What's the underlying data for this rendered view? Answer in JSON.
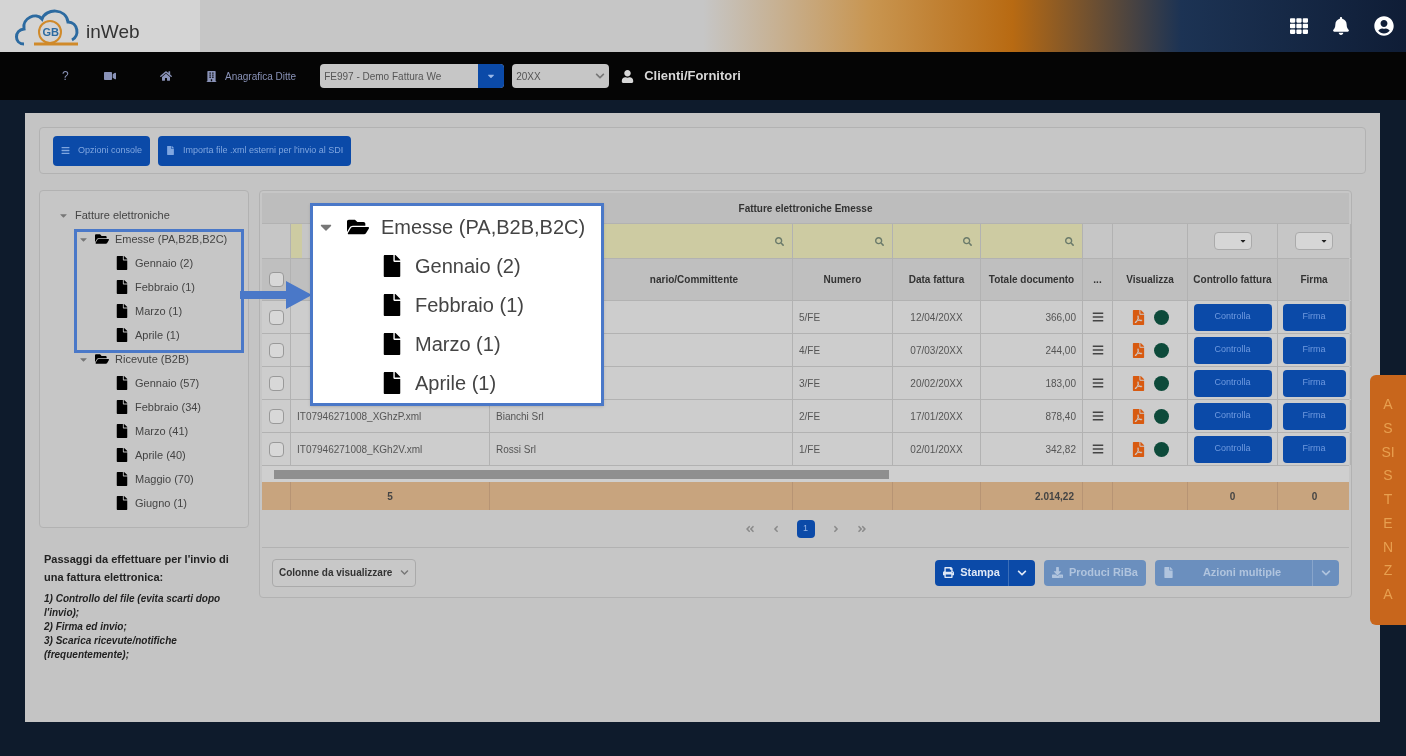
{
  "logo": {
    "mark": "GB",
    "name": "inWeb"
  },
  "nav": {
    "help": "?",
    "company_label": "Anagrafica Ditte",
    "company_select": "FE997 - Demo Fattura We",
    "year_select": "20XX",
    "user": "Clienti/Fornitori"
  },
  "toolbar": {
    "buttons": [
      {
        "kind": "menu",
        "label": "Opzioni console"
      },
      {
        "kind": "file",
        "label": "Importa file .xml esterni per l'invio al SDI"
      }
    ]
  },
  "tree": {
    "label": "Fatture elettroniche",
    "expanded": true,
    "children": [
      {
        "kind": "folder",
        "label": "Emesse (PA,B2B,B2C)",
        "expanded": true,
        "children": [
          {
            "kind": "file",
            "label": "Gennaio (2)"
          },
          {
            "kind": "file",
            "label": "Febbraio (1)"
          },
          {
            "kind": "file",
            "label": "Marzo (1)"
          },
          {
            "kind": "file",
            "label": "Aprile (1)"
          }
        ]
      },
      {
        "kind": "folder",
        "label": "Ricevute (B2B)",
        "expanded": true,
        "children": [
          {
            "kind": "file",
            "label": "Gennaio (57)"
          },
          {
            "kind": "file",
            "label": "Febbraio (34)"
          },
          {
            "kind": "file",
            "label": "Marzo (41)"
          },
          {
            "kind": "file",
            "label": "Aprile (40)"
          },
          {
            "kind": "file",
            "label": "Maggio (70)"
          },
          {
            "kind": "file",
            "label": "Giugno (1)"
          }
        ]
      }
    ]
  },
  "instructions": {
    "title": "Passaggi da effettuare per l'invio di una fattura elettronica:",
    "steps": [
      "1) Controllo del file (evita scarti dopo l'invio);",
      "2) Firma ed invio;",
      "3) Scarica ricevute/notifiche (frequentemente);"
    ]
  },
  "table": {
    "title": "Fatture elettroniche Emesse",
    "all_selected": false,
    "headers": {
      "party": "nario/Committente",
      "number": "Numero",
      "date": "Data fattura",
      "total": "Totale documento",
      "more": "...",
      "view": "Visualizza",
      "check": "Controllo fattura",
      "sign": "Firma"
    },
    "rows": [
      {
        "selected": false,
        "number": "5/FE",
        "date": "12/04/20XX",
        "total": "366,00",
        "check_button": "Controlla",
        "sign_button": "Firma"
      },
      {
        "selected": false,
        "number": "4/FE",
        "date": "07/03/20XX",
        "total": "244,00",
        "check_button": "Controlla",
        "sign_button": "Firma"
      },
      {
        "selected": false,
        "number": "3/FE",
        "date": "20/02/20XX",
        "total": "183,00",
        "check_button": "Controlla",
        "sign_button": "Firma"
      },
      {
        "selected": false,
        "file": "IT07946271008_XGhzP.xml",
        "party": "Bianchi Srl",
        "number": "2/FE",
        "date": "17/01/20XX",
        "total": "878,40",
        "check_button": "Controlla",
        "sign_button": "Firma"
      },
      {
        "selected": false,
        "file": "IT07946271008_KGh2V.xml",
        "party": "Rossi Srl",
        "number": "1/FE",
        "date": "02/01/20XX",
        "total": "342,82",
        "check_button": "Controlla",
        "sign_button": "Firma"
      }
    ],
    "totals": {
      "count": "5",
      "total": "2.014,22",
      "checked": "0",
      "signed": "0"
    },
    "pages": [
      {
        "label": "1",
        "selected": true
      }
    ],
    "columns_select": "Colonne da visualizzare",
    "actions": [
      {
        "kind": "split",
        "label": "Stampa",
        "disabled": false
      },
      {
        "kind": "plain",
        "label": "Produci RiBa",
        "disabled": true
      },
      {
        "kind": "split",
        "label": "Azioni multiple",
        "disabled": true
      }
    ]
  },
  "callout": {
    "kind": "folder",
    "label": "Emesse (PA,B2B,B2C)",
    "expanded": true,
    "children": [
      {
        "kind": "file",
        "label": "Gennaio (2)"
      },
      {
        "kind": "file",
        "label": "Febbraio (1)"
      },
      {
        "kind": "file",
        "label": "Marzo (1)"
      },
      {
        "kind": "file",
        "label": "Aprile (1)"
      }
    ]
  },
  "assistance_tab": "ASSISTENZA"
}
